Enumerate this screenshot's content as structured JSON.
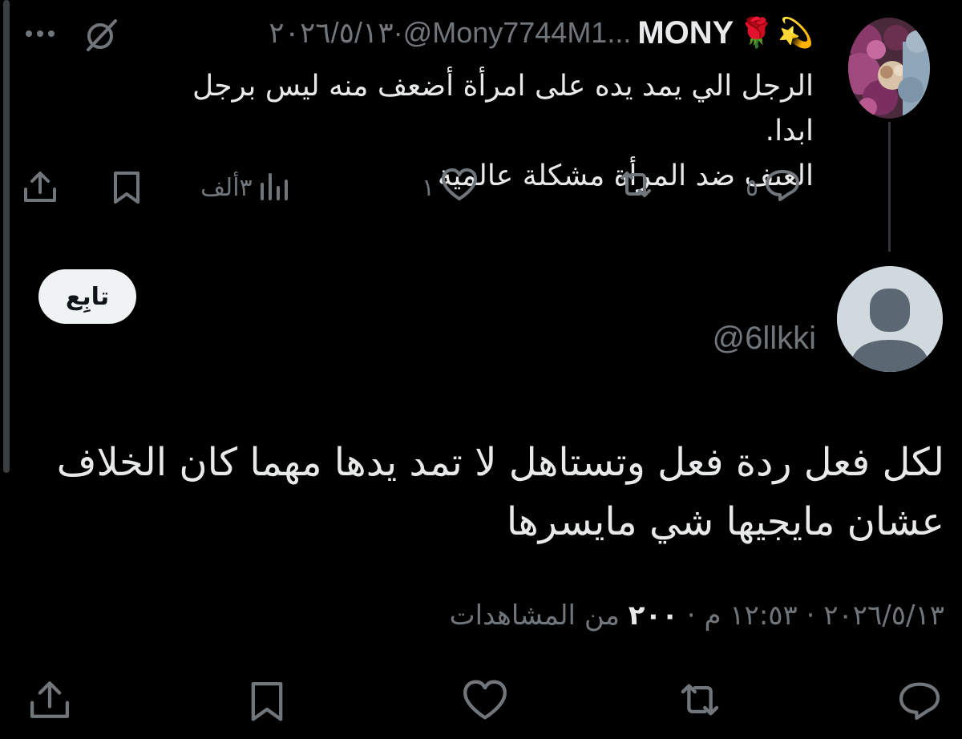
{
  "parent_tweet": {
    "display_name": "MONY",
    "emoji_dizzy": "💫",
    "emoji_rose": "🌹",
    "handle": "@Mony7744M1...",
    "separator": " · ",
    "date": "٢٠٢٦/٥/١٣",
    "text_line1": "الرجل الي يمد يده على امرأة أضعف منه ليس برجل ابدا.",
    "text_line2": "العنف ضد المرأة مشكلة عالمية",
    "actions": {
      "replies": "٥",
      "retweets": "",
      "likes": "١",
      "views": "٣ألف"
    },
    "icons": {
      "reply": "comment-icon",
      "retweet": "retweet-icon",
      "like": "heart-icon",
      "views": "analytics-icon",
      "bookmark": "bookmark-icon",
      "share": "share-icon",
      "grok": "grok-icon",
      "more": "more-icon"
    }
  },
  "reply_tweet": {
    "handle": "@6llkki",
    "follow_label": "تابِع",
    "text_line1": "لكل فعل ردة فعل وتستاهل لا تمد يدها مهما كان الخلاف",
    "text_line2": "عشان مايجيها شي مايسرها",
    "date": "٢٠٢٦/٥/١٣",
    "dot": " · ",
    "time": "١٢:٥٣ م",
    "views_count": "٢٠٠",
    "views_label": "من المشاهدات"
  },
  "colors": {
    "background": "#000000",
    "text_primary": "#e7e9ea",
    "text_secondary": "#71767b",
    "follow_bg": "#eff3f4",
    "avatar_placeholder": "#cfd9de"
  }
}
